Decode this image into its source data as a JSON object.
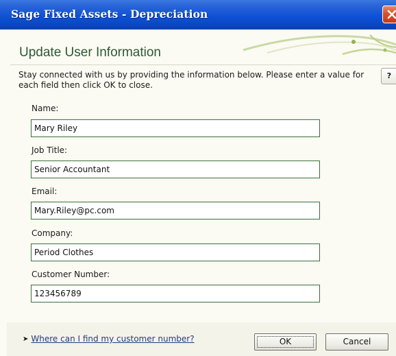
{
  "window": {
    "title": "Sage Fixed Assets - Depreciation"
  },
  "icons": {
    "close": "close-x-icon",
    "help": "help-question-icon",
    "link_arrow": "arrow-right-icon",
    "swoosh": "decorative-swoosh"
  },
  "dialog": {
    "heading": "Update User Information",
    "intro": "Stay connected with us by providing the information below.  Please enter a value for each field then click OK to close.",
    "help_label": "?"
  },
  "fields": {
    "name": {
      "label": "Name:",
      "value": "Mary Riley"
    },
    "job_title": {
      "label": "Job Title:",
      "value": "Senior Accountant"
    },
    "email": {
      "label": "Email:",
      "value": "Mary.Riley@pc.com"
    },
    "company": {
      "label": "Company:",
      "value": "Period Clothes"
    },
    "customer_number": {
      "label": "Customer Number:",
      "value": "123456789"
    }
  },
  "footer": {
    "help_link": "Where can I find my customer number?",
    "ok_label": "OK",
    "cancel_label": "Cancel"
  },
  "colors": {
    "titlebar": "#0e52d6",
    "heading": "#2c5a35",
    "input_border": "#3c6e3c",
    "link": "#1b3f7a",
    "close_button": "#d9512a"
  }
}
